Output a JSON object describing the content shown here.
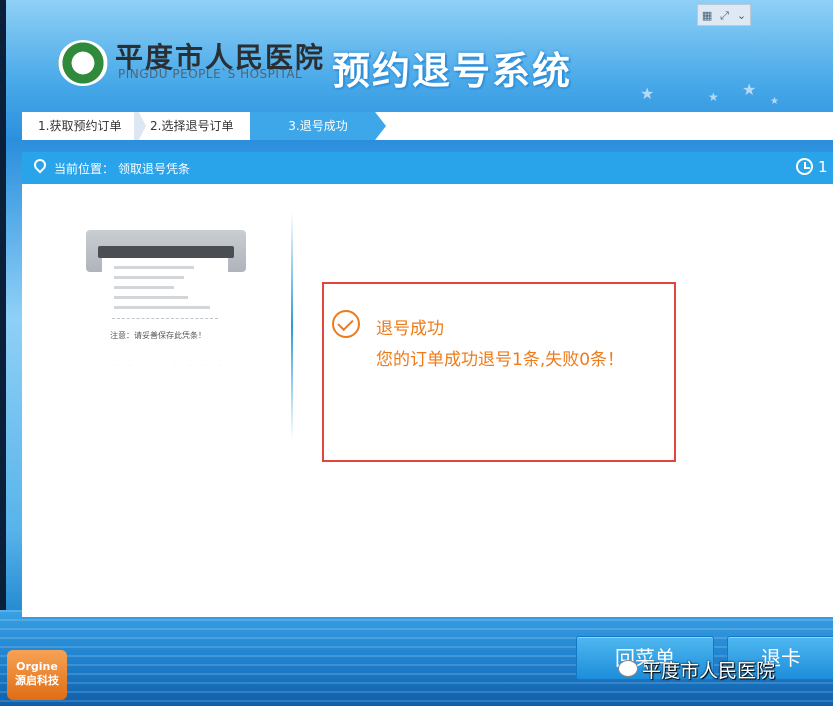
{
  "header": {
    "hospital_name": "平度市人民医院",
    "hospital_name_en": "PINGDU PEOPLE`S HOSPITAL",
    "system_title": "预约退号系统"
  },
  "window_controls": {
    "grid_glyph": "▦",
    "expand_glyph": "⤢",
    "collapse_glyph": "⌄"
  },
  "steps": [
    {
      "label": "1.获取预约订单",
      "active": false
    },
    {
      "label": "2.选择退号订单",
      "active": false
    },
    {
      "label": "3.退号成功",
      "active": true
    }
  ],
  "location": {
    "label": "当前位置：",
    "value": "领取退号凭条",
    "clock_text": "1"
  },
  "receipt": {
    "note": "注意：请妥善保存此凭条！"
  },
  "result": {
    "title": "退号成功",
    "message": "您的订单成功退号1条,失败0条！"
  },
  "buttons": {
    "menu": "回菜单",
    "card": "退卡"
  },
  "watermark": "平度市人民医院",
  "company_logo": {
    "line1": "Orgine",
    "line2": "源启科技"
  },
  "colors": {
    "accent_blue": "#29a3ea",
    "success_orange": "#ee7b1a",
    "highlight_red": "#e0453f"
  },
  "icons": [
    "location-pin-icon",
    "clock-icon",
    "check-circle-icon",
    "hospital-logo-icon",
    "wechat-icon"
  ]
}
